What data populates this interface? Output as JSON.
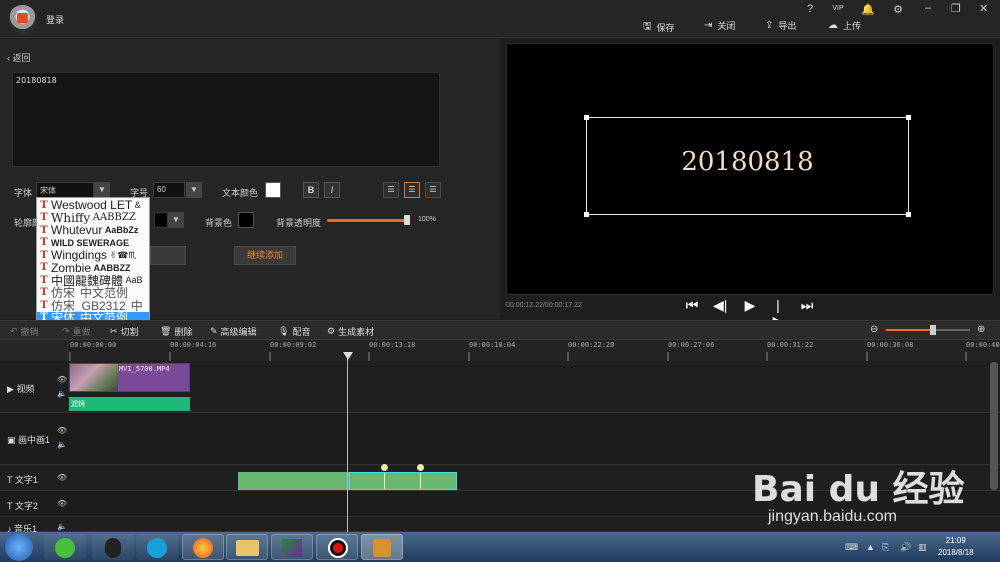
{
  "app": {
    "login": "登录",
    "top_icons": [
      "?",
      "VIP",
      "🔔",
      "⚙"
    ],
    "window_btns": [
      "–",
      "❐",
      "✕"
    ],
    "top_actions": [
      {
        "label": "保存",
        "icon": "save-icon"
      },
      {
        "label": "关闭",
        "icon": "exit-icon"
      },
      {
        "label": "导出",
        "icon": "export-icon"
      },
      {
        "label": "上传",
        "icon": "upload-icon"
      }
    ]
  },
  "editor": {
    "back_label": "返回",
    "text_value": "20180818",
    "font_label": "字体",
    "font_value": "宋体",
    "size_label": "字号",
    "size_value": "60",
    "color_label": "文本颜色",
    "text_color": "#ffffff",
    "bold": "B",
    "italic": "I",
    "outline_label": "轮廓颜",
    "bg_color_label": "背景色",
    "bg_color": "#000000",
    "bg_opacity_label": "背景透明度",
    "bg_opacity_value": "100%",
    "bg_opacity": 1.0,
    "apply_label": "",
    "continue_label": "继续添加"
  },
  "font_list": [
    {
      "name": "Westwood LET",
      "sample": "&"
    },
    {
      "name": "Whiffy",
      "sample": "AABBZZ"
    },
    {
      "name": "Whutevur",
      "sample": "AaBbZz"
    },
    {
      "name": "WILD SEWERAGE",
      "sample": ""
    },
    {
      "name": "Wingdings",
      "sample": "✌☎♏"
    },
    {
      "name": "Zombie",
      "sample": "AABBZZ"
    },
    {
      "name": "中國龍魏碑體",
      "sample": "AaB"
    },
    {
      "name": "仿宋",
      "sample": "中文范例"
    },
    {
      "name": "仿宋_GB2312",
      "sample": "中"
    },
    {
      "name": "宋体",
      "sample": "中文范例",
      "selected": true
    }
  ],
  "preview": {
    "text": "20180818",
    "time": "00:00:12.22/00:00:17.22"
  },
  "toolbar": {
    "undo": "撤销",
    "redo": "重做",
    "cut": "切割",
    "delete": "删除",
    "advanced": "高级编辑",
    "dub": "配音",
    "generate": "生成素材",
    "zoom_level": 0.55
  },
  "timeline": {
    "ticks": [
      "00:00:00:00",
      "00:00:04:16",
      "00:00:09:02",
      "00:00:13:18",
      "00:00:18:04",
      "00:00:22:20",
      "00:00:27:06",
      "00:00:31:22",
      "00:00:36:08",
      "00:00:40:"
    ],
    "tracks": [
      {
        "name": "视频",
        "icon": "video-track-icon"
      },
      {
        "name": "画中画1",
        "icon": "pip-track-icon"
      },
      {
        "name": "文字1",
        "icon": "text-track-icon"
      },
      {
        "name": "文字2",
        "icon": "text-track-icon"
      },
      {
        "name": "音乐1",
        "icon": "music-track-icon"
      }
    ],
    "video_clip": "MVI_5700.MP4",
    "filter_clip": "滤镜",
    "playhead_time": "00:00:12:22"
  },
  "taskbar": {
    "time": "21:09",
    "date": "2018/8/18"
  },
  "watermark": {
    "brand": "Bai du 经验",
    "url": "jingyan.baidu.com"
  }
}
